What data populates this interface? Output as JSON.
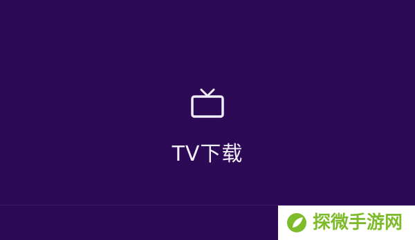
{
  "tv_download": {
    "icon": "tv-icon",
    "label": "TV下载"
  },
  "watermark": {
    "logo_icon": "leaf-logo-icon",
    "text": "探微手游网"
  },
  "colors": {
    "background": "#2d0a55",
    "text": "#f2eef8",
    "watermark_green": "#7dbb2a",
    "watermark_bg": "#ffffff"
  }
}
